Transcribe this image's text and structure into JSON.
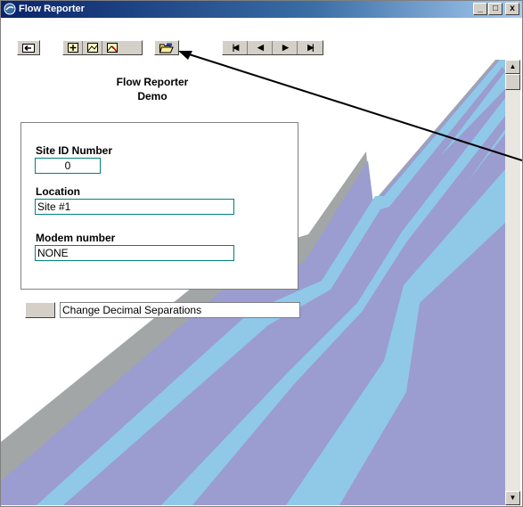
{
  "window": {
    "title": "Flow Reporter"
  },
  "title_buttons": {
    "minimize": "_",
    "maximize": "□",
    "close": "x"
  },
  "header": {
    "line1": "Flow Reporter",
    "line2": "Demo"
  },
  "form": {
    "site_id_label": "Site ID Number",
    "site_id_value": "0",
    "location_label": "Location",
    "location_value": "Site #1",
    "modem_label": "Modem number",
    "modem_value": "NONE"
  },
  "decimal": {
    "label": "Change Decimal Separations"
  },
  "icons": {
    "exit": "exit-icon",
    "add": "add-icon",
    "image": "image-icon",
    "delete": "delete-image-icon",
    "open": "folder-open-icon",
    "first": "first-record-icon",
    "prev": "previous-record-icon",
    "next": "next-record-icon",
    "last": "last-record-icon"
  },
  "colors": {
    "stream_dark": "#9b9ccf",
    "stream_light": "#90c8e8",
    "bank": "#a2a6a6",
    "title_bar": "#0a246a"
  }
}
